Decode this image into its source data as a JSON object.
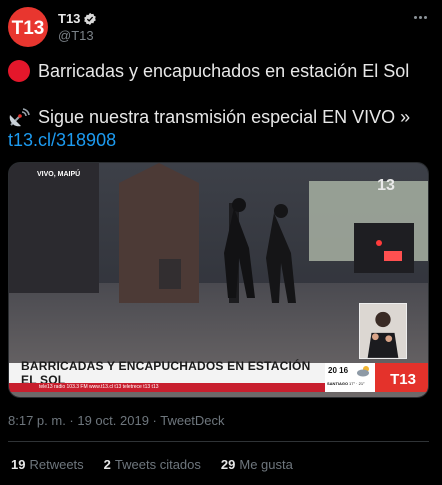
{
  "author": {
    "display_name": "T13",
    "handle": "@T13",
    "avatar_logo": "T13",
    "verified_icon": "verified-badge-icon"
  },
  "tweet": {
    "line1": "Barricadas y encapuchados en estación El Sol",
    "line2": "Sigue nuestra transmisión especial EN VIVO »",
    "link": "t13.cl/318908"
  },
  "media": {
    "live_label": "VIVO, MAIPÚ",
    "corner_logo": "13",
    "banner": "BARRICADAS Y ENCAPUCHADOS EN ESTACIÓN EL SOL",
    "ticker": "tele13 radio 103.3 FM   www.t13.cl   t13   teletrece   t13   t13",
    "weather_time": "20 16",
    "weather_city": "SANTIAGO",
    "weather_range": "17° · 21°",
    "bottom_logo": "T13"
  },
  "meta": {
    "timestamp": "8:17 p. m. · 19 oct. 2019 · TweetDeck"
  },
  "stats": {
    "retweets_count": "19",
    "retweets_label": "Retweets",
    "quotes_count": "2",
    "quotes_label": "Tweets citados",
    "likes_count": "29",
    "likes_label": "Me gusta"
  },
  "colors": {
    "accent_link": "#1d9bf0",
    "brand_red": "#e4322b",
    "background": "#000000"
  }
}
